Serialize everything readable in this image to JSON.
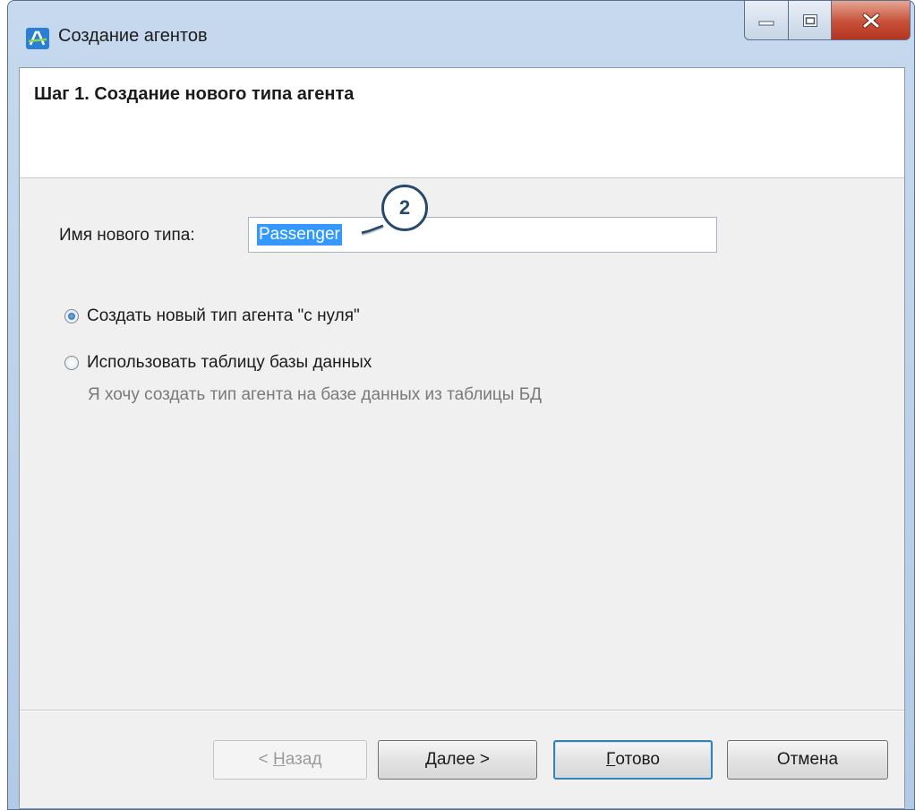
{
  "window": {
    "title": "Создание агентов",
    "buttons": {
      "minimize": "minimize",
      "maximize": "maximize",
      "close": "close"
    }
  },
  "header": {
    "step_title": "Шаг 1. Создание нового типа агента"
  },
  "form": {
    "name_label": "Имя нового типа:",
    "name_value": "Passenger",
    "callout_number": "2"
  },
  "options": [
    {
      "label": "Создать новый тип агента \"с нуля\"",
      "checked": true
    },
    {
      "label": "Использовать таблицу базы данных",
      "checked": false
    }
  ],
  "hint": "Я хочу создать тип агента на базе данных из таблицы БД",
  "footer": {
    "back_prefix": "< ",
    "back_mnemonic": "Н",
    "back_rest": "азад",
    "next_mnemonic": "Д",
    "next_rest": "алее >",
    "finish_mnemonic": "Г",
    "finish_rest": "отово",
    "cancel": "Отмена"
  },
  "colors": {
    "selection": "#3399ff",
    "callout_border": "#274a6b",
    "close_button": "#c75038"
  }
}
